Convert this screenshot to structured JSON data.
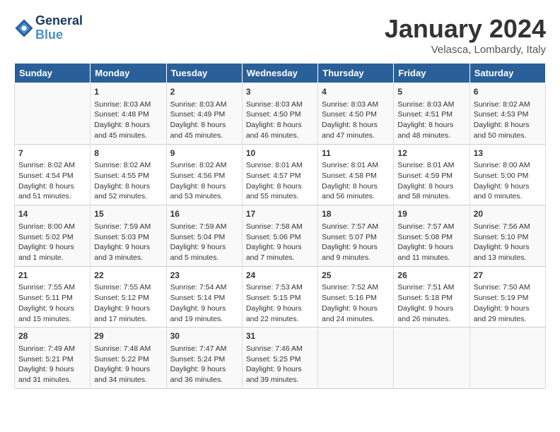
{
  "header": {
    "logo_line1": "General",
    "logo_line2": "Blue",
    "month": "January 2024",
    "location": "Velasca, Lombardy, Italy"
  },
  "days_of_week": [
    "Sunday",
    "Monday",
    "Tuesday",
    "Wednesday",
    "Thursday",
    "Friday",
    "Saturday"
  ],
  "weeks": [
    [
      {
        "day": "",
        "content": ""
      },
      {
        "day": "1",
        "content": "Sunrise: 8:03 AM\nSunset: 4:48 PM\nDaylight: 8 hours\nand 45 minutes."
      },
      {
        "day": "2",
        "content": "Sunrise: 8:03 AM\nSunset: 4:49 PM\nDaylight: 8 hours\nand 45 minutes."
      },
      {
        "day": "3",
        "content": "Sunrise: 8:03 AM\nSunset: 4:50 PM\nDaylight: 8 hours\nand 46 minutes."
      },
      {
        "day": "4",
        "content": "Sunrise: 8:03 AM\nSunset: 4:50 PM\nDaylight: 8 hours\nand 47 minutes."
      },
      {
        "day": "5",
        "content": "Sunrise: 8:03 AM\nSunset: 4:51 PM\nDaylight: 8 hours\nand 48 minutes."
      },
      {
        "day": "6",
        "content": "Sunrise: 8:02 AM\nSunset: 4:53 PM\nDaylight: 8 hours\nand 50 minutes."
      }
    ],
    [
      {
        "day": "7",
        "content": "Sunrise: 8:02 AM\nSunset: 4:54 PM\nDaylight: 8 hours\nand 51 minutes."
      },
      {
        "day": "8",
        "content": "Sunrise: 8:02 AM\nSunset: 4:55 PM\nDaylight: 8 hours\nand 52 minutes."
      },
      {
        "day": "9",
        "content": "Sunrise: 8:02 AM\nSunset: 4:56 PM\nDaylight: 8 hours\nand 53 minutes."
      },
      {
        "day": "10",
        "content": "Sunrise: 8:01 AM\nSunset: 4:57 PM\nDaylight: 8 hours\nand 55 minutes."
      },
      {
        "day": "11",
        "content": "Sunrise: 8:01 AM\nSunset: 4:58 PM\nDaylight: 8 hours\nand 56 minutes."
      },
      {
        "day": "12",
        "content": "Sunrise: 8:01 AM\nSunset: 4:59 PM\nDaylight: 8 hours\nand 58 minutes."
      },
      {
        "day": "13",
        "content": "Sunrise: 8:00 AM\nSunset: 5:00 PM\nDaylight: 9 hours\nand 0 minutes."
      }
    ],
    [
      {
        "day": "14",
        "content": "Sunrise: 8:00 AM\nSunset: 5:02 PM\nDaylight: 9 hours\nand 1 minute."
      },
      {
        "day": "15",
        "content": "Sunrise: 7:59 AM\nSunset: 5:03 PM\nDaylight: 9 hours\nand 3 minutes."
      },
      {
        "day": "16",
        "content": "Sunrise: 7:59 AM\nSunset: 5:04 PM\nDaylight: 9 hours\nand 5 minutes."
      },
      {
        "day": "17",
        "content": "Sunrise: 7:58 AM\nSunset: 5:06 PM\nDaylight: 9 hours\nand 7 minutes."
      },
      {
        "day": "18",
        "content": "Sunrise: 7:57 AM\nSunset: 5:07 PM\nDaylight: 9 hours\nand 9 minutes."
      },
      {
        "day": "19",
        "content": "Sunrise: 7:57 AM\nSunset: 5:08 PM\nDaylight: 9 hours\nand 11 minutes."
      },
      {
        "day": "20",
        "content": "Sunrise: 7:56 AM\nSunset: 5:10 PM\nDaylight: 9 hours\nand 13 minutes."
      }
    ],
    [
      {
        "day": "21",
        "content": "Sunrise: 7:55 AM\nSunset: 5:11 PM\nDaylight: 9 hours\nand 15 minutes."
      },
      {
        "day": "22",
        "content": "Sunrise: 7:55 AM\nSunset: 5:12 PM\nDaylight: 9 hours\nand 17 minutes."
      },
      {
        "day": "23",
        "content": "Sunrise: 7:54 AM\nSunset: 5:14 PM\nDaylight: 9 hours\nand 19 minutes."
      },
      {
        "day": "24",
        "content": "Sunrise: 7:53 AM\nSunset: 5:15 PM\nDaylight: 9 hours\nand 22 minutes."
      },
      {
        "day": "25",
        "content": "Sunrise: 7:52 AM\nSunset: 5:16 PM\nDaylight: 9 hours\nand 24 minutes."
      },
      {
        "day": "26",
        "content": "Sunrise: 7:51 AM\nSunset: 5:18 PM\nDaylight: 9 hours\nand 26 minutes."
      },
      {
        "day": "27",
        "content": "Sunrise: 7:50 AM\nSunset: 5:19 PM\nDaylight: 9 hours\nand 29 minutes."
      }
    ],
    [
      {
        "day": "28",
        "content": "Sunrise: 7:49 AM\nSunset: 5:21 PM\nDaylight: 9 hours\nand 31 minutes."
      },
      {
        "day": "29",
        "content": "Sunrise: 7:48 AM\nSunset: 5:22 PM\nDaylight: 9 hours\nand 34 minutes."
      },
      {
        "day": "30",
        "content": "Sunrise: 7:47 AM\nSunset: 5:24 PM\nDaylight: 9 hours\nand 36 minutes."
      },
      {
        "day": "31",
        "content": "Sunrise: 7:46 AM\nSunset: 5:25 PM\nDaylight: 9 hours\nand 39 minutes."
      },
      {
        "day": "",
        "content": ""
      },
      {
        "day": "",
        "content": ""
      },
      {
        "day": "",
        "content": ""
      }
    ]
  ]
}
